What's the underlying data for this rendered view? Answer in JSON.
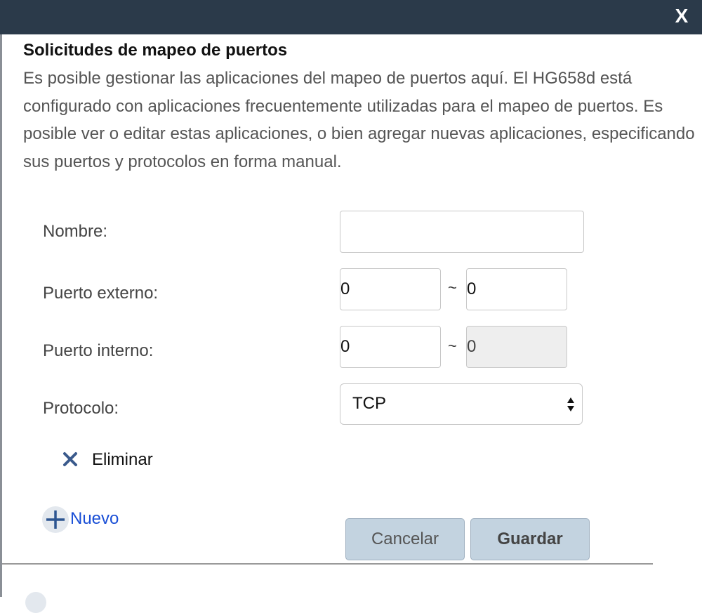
{
  "dialog": {
    "close_label": "X",
    "title": "Solicitudes de mapeo de puertos",
    "description": "Es posible gestionar las aplicaciones del mapeo de puertos aquí. El HG658d está configurado con aplicaciones frecuentemente utilizadas para el mapeo de puertos. Es posible ver o editar estas aplicaciones, o bien agregar nuevas aplicaciones, especificando sus puertos y protocolos en forma manual."
  },
  "form": {
    "name": {
      "label": "Nombre:",
      "value": ""
    },
    "external_port": {
      "label": "Puerto externo:",
      "start": "0",
      "end": "0",
      "separator": "~"
    },
    "internal_port": {
      "label": "Puerto interno:",
      "start": "0",
      "end": "0",
      "separator": "~"
    },
    "protocol": {
      "label": "Protocolo:",
      "selected": "TCP"
    }
  },
  "actions": {
    "delete_label": "Eliminar",
    "new_label": "Nuevo",
    "cancel_label": "Cancelar",
    "save_label": "Guardar"
  },
  "icons": {
    "close": "close-icon",
    "delete": "x-icon",
    "new": "plus-icon",
    "select": "up-down-arrows-icon"
  },
  "colors": {
    "topbar": "#2b3a4a",
    "button_bg": "#c3d3e0",
    "link": "#1a4fd6",
    "delete_icon": "#3a5a8c",
    "plus_icon": "#2d5590",
    "disabled_input": "#eeeeee"
  }
}
